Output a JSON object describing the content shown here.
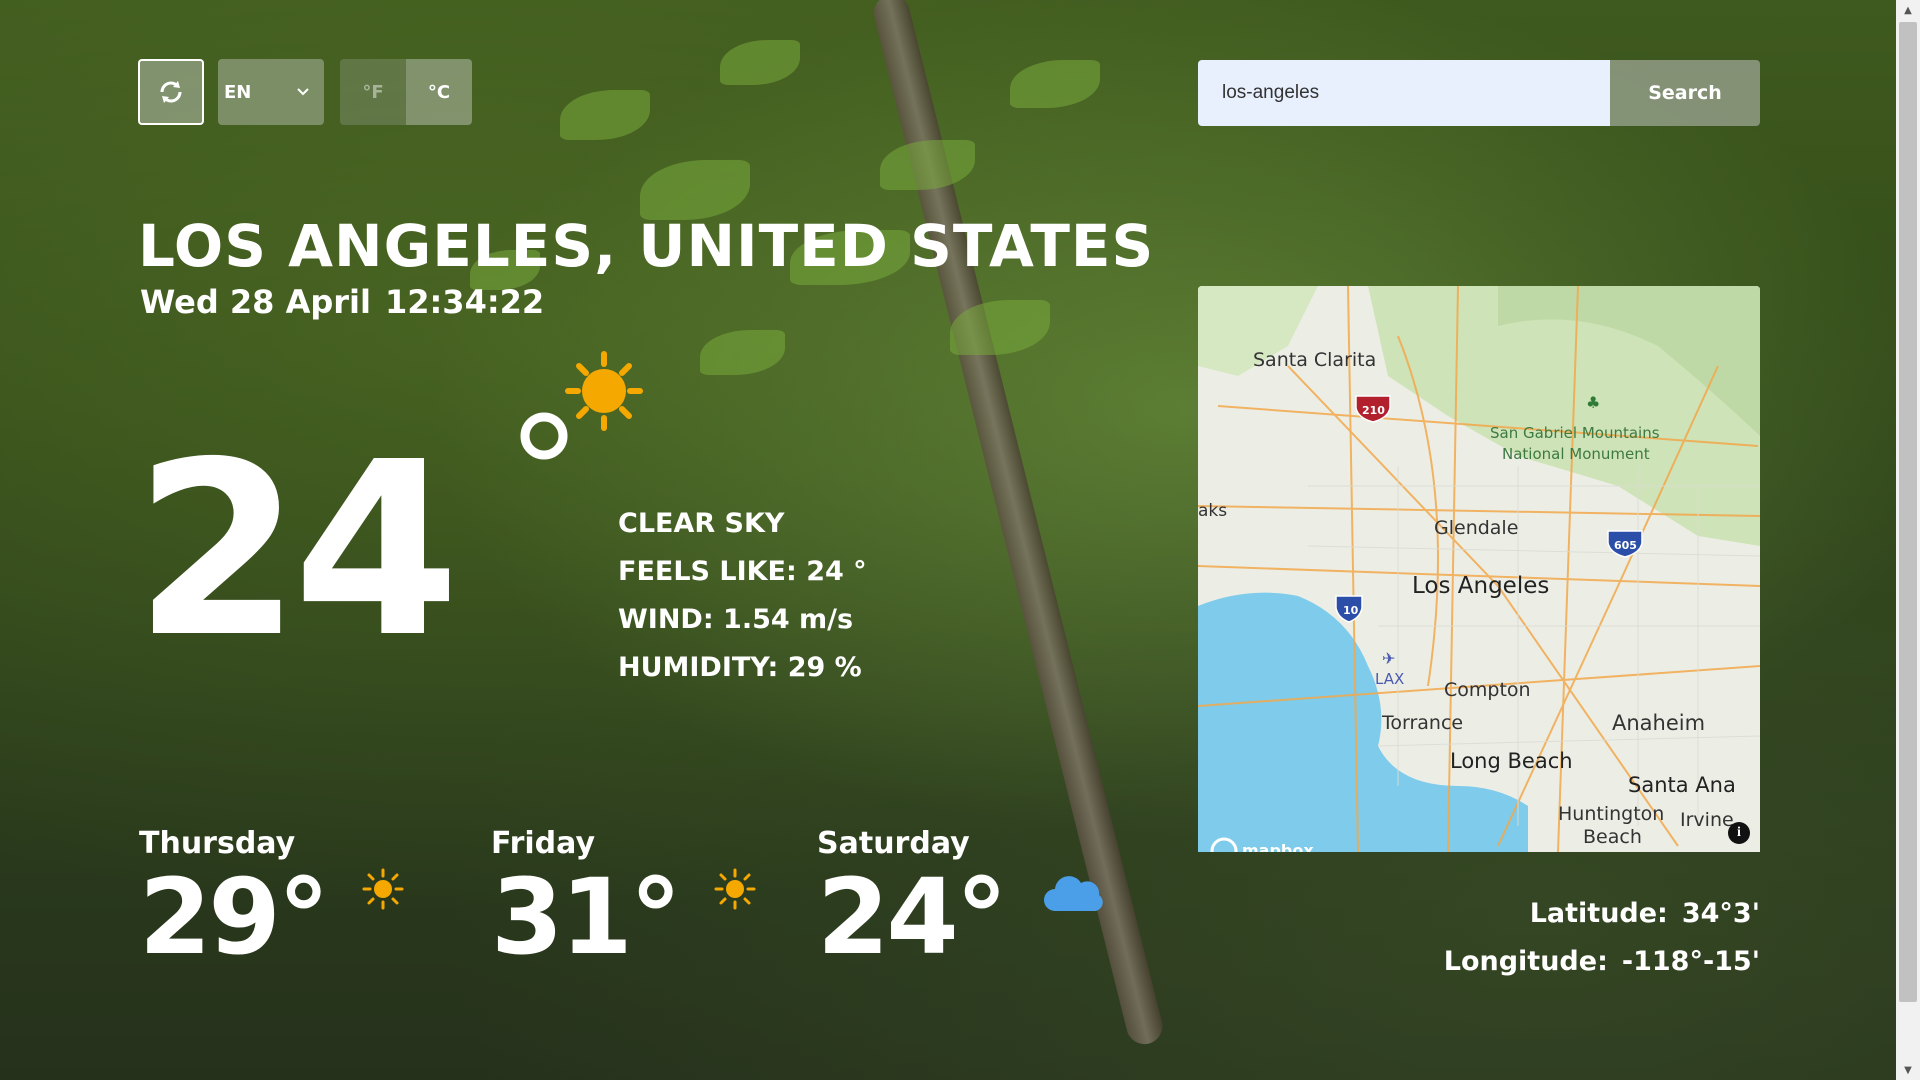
{
  "controls": {
    "language": "EN",
    "unit_f": "°F",
    "unit_c": "°C",
    "active_unit": "°C"
  },
  "search": {
    "value": "los-angeles",
    "button_label": "Search"
  },
  "location": {
    "title": "LOS ANGELES, UNITED STATES",
    "date": "Wed 28 April",
    "time": "12:34:22"
  },
  "current": {
    "temperature": "24",
    "condition": "CLEAR SKY",
    "feels_like": "FEELS LIKE: 24 °",
    "wind": "WIND: 1.54 m/s",
    "humidity": "HUMIDITY: 29 %",
    "icon": "clear-day-icon"
  },
  "forecast": [
    {
      "day": "Thursday",
      "temp": "29°",
      "icon": "sun-icon"
    },
    {
      "day": "Friday",
      "temp": "31°",
      "icon": "sun-icon"
    },
    {
      "day": "Saturday",
      "temp": "24°",
      "icon": "cloud-icon"
    }
  ],
  "map": {
    "labels": {
      "santa_clarita": "Santa Clarita",
      "san_gabriel": "San Gabriel Mountains",
      "national_monument": "National Monument",
      "oaks": "aks",
      "glendale": "Glendale",
      "los_angeles": "Los Angeles",
      "lax": "LAX",
      "compton": "Compton",
      "torrance": "Torrance",
      "anaheim": "Anaheim",
      "long_beach": "Long Beach",
      "santa_ana": "Santa Ana",
      "huntington": "Huntington",
      "beach": "Beach",
      "irvine": "Irvine",
      "i210": "210",
      "i605": "605",
      "i10": "10",
      "attribution": "mapbox"
    },
    "info": "i"
  },
  "coordinates": {
    "latitude_label": "Latitude:",
    "latitude_value": "34°3'",
    "longitude_label": "Longitude:",
    "longitude_value": "-118°-15'"
  },
  "colors": {
    "sun": "#f5a800",
    "cloud": "#4a9fe8",
    "water": "#7ecbeb"
  }
}
